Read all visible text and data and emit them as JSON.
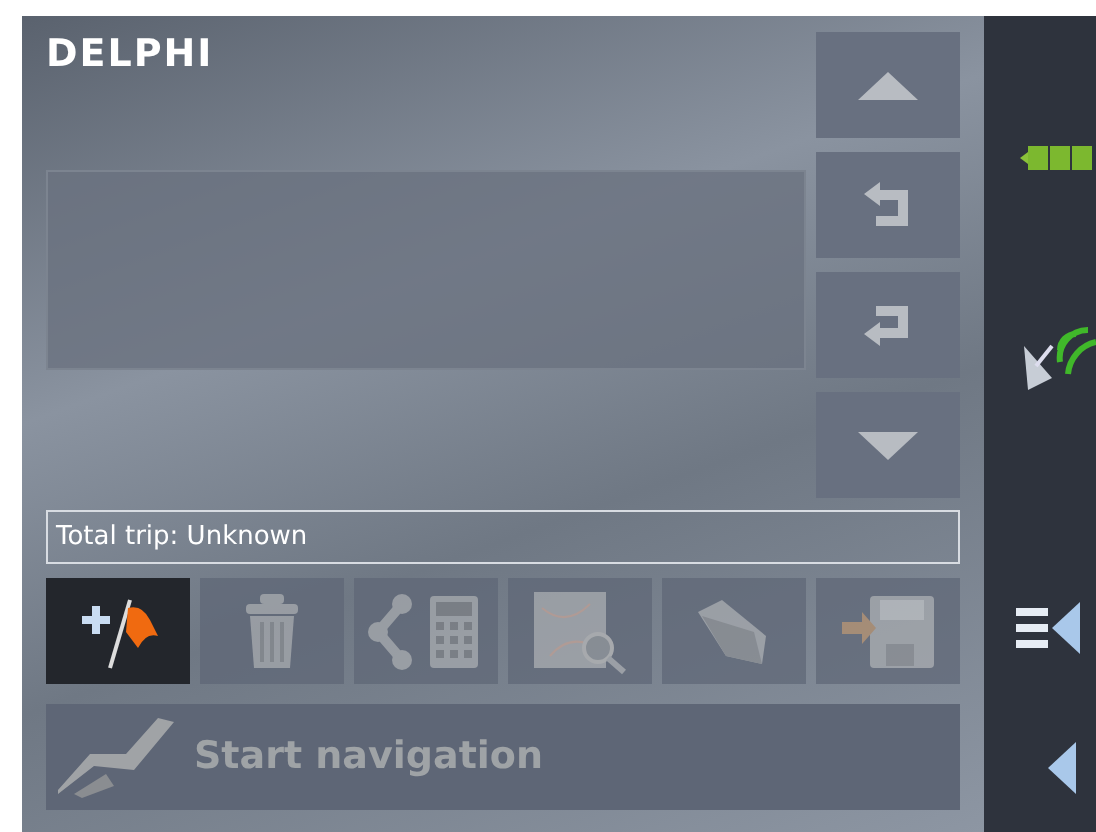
{
  "logo": "DELPHI",
  "scroll_buttons": [
    {
      "kind": "up"
    },
    {
      "kind": "back"
    },
    {
      "kind": "forward"
    },
    {
      "kind": "down"
    }
  ],
  "total_trip": "Total trip: Unknown",
  "tools": [
    {
      "kind": "add-destination",
      "disabled": false
    },
    {
      "kind": "delete",
      "disabled": true
    },
    {
      "kind": "route-calc",
      "disabled": true
    },
    {
      "kind": "map-search",
      "disabled": true
    },
    {
      "kind": "open",
      "disabled": true
    },
    {
      "kind": "save",
      "disabled": true
    }
  ],
  "start_navigation": {
    "label": "Start navigation",
    "disabled": true
  }
}
